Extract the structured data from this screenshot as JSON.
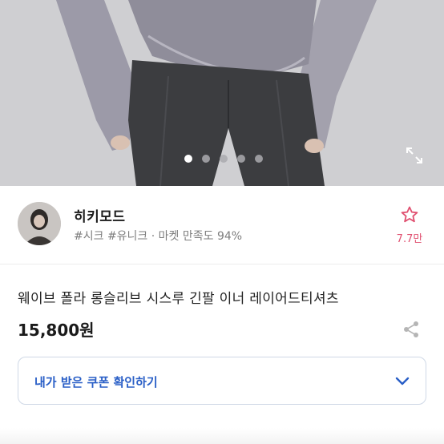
{
  "gallery": {
    "dot_count": 5,
    "active_index": 0,
    "expand_icon": "expand-icon"
  },
  "seller": {
    "name": "히키모드",
    "tags": "#시크 #유니크 · 마켓 만족도 94%",
    "favorite_icon": "star-outline-icon",
    "favorite_count": "7.7만",
    "accent_color": "#e05070"
  },
  "product": {
    "name": "웨이브 폴라 롱슬리브 시스루 긴팔 이너 레이어드티셔츠",
    "price": "15,800원",
    "share_icon": "share-icon"
  },
  "coupon": {
    "label": "내가 받은 쿠폰 확인하기",
    "chevron_icon": "chevron-down-icon",
    "accent_color": "#2a5fc7"
  }
}
